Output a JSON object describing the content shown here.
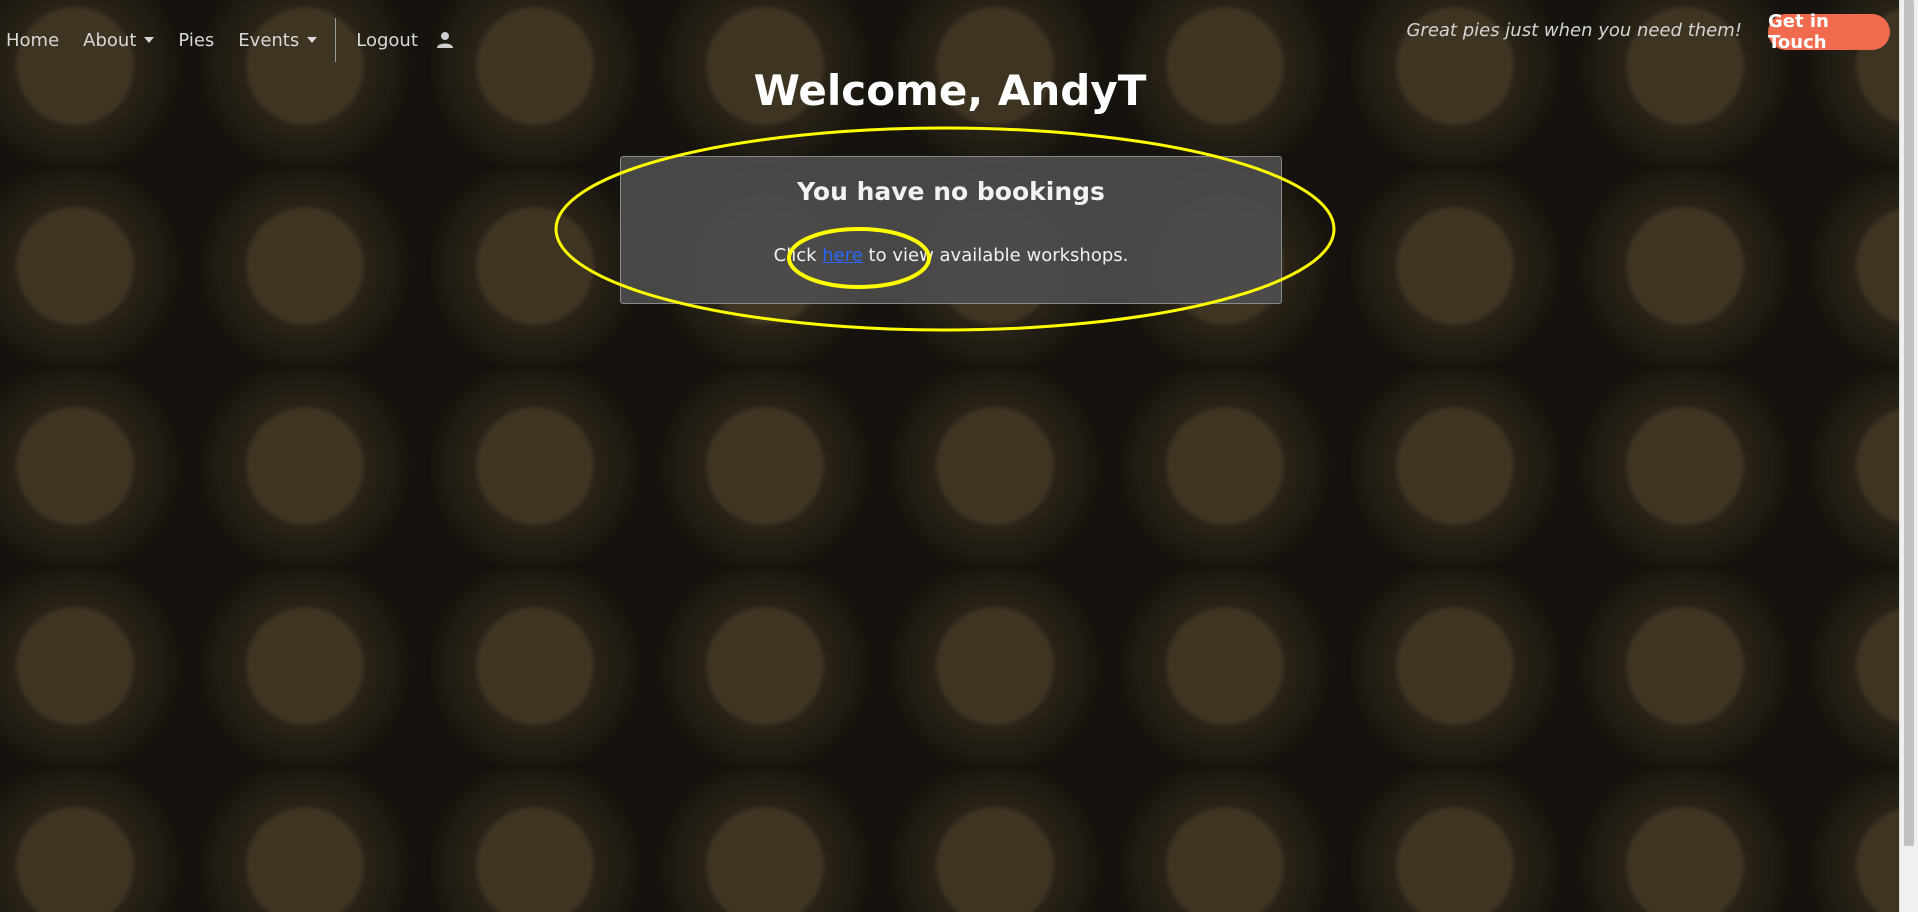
{
  "nav": {
    "items": [
      {
        "label": "Home",
        "has_dropdown": false
      },
      {
        "label": "About",
        "has_dropdown": true
      },
      {
        "label": "Pies",
        "has_dropdown": false
      },
      {
        "label": "Events",
        "has_dropdown": true
      }
    ],
    "logout_label": "Logout",
    "user_icon": "user-icon",
    "tagline": "Great pies just when you need them!",
    "cta_label": "Get in Touch"
  },
  "page": {
    "welcome": "Welcome, AndyT"
  },
  "bookings": {
    "title": "You have no bookings",
    "text_before": "Click",
    "link_label": "here",
    "text_after": "to view available workshops."
  },
  "colors": {
    "cta": "#f06a4d",
    "link": "#2a67ff",
    "highlight": "#ffff00"
  }
}
